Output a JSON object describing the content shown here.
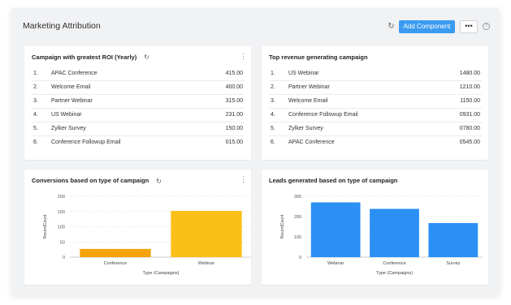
{
  "header": {
    "title": "Marketing Attribution",
    "add_component_label": "Add Component",
    "more_label": "•••",
    "help_label": "?"
  },
  "icons": {
    "refresh": "refresh-icon",
    "menu": "vertical-dots-icon",
    "help": "help-icon"
  },
  "widgets": {
    "roi": {
      "title": "Campaign with greatest ROI (Yearly)",
      "rows": [
        {
          "rank": "1.",
          "name": "APAC Conference",
          "value": "415.00"
        },
        {
          "rank": "2.",
          "name": "Welcome Email",
          "value": "400.00"
        },
        {
          "rank": "3.",
          "name": "Partner Webinar",
          "value": "315.00"
        },
        {
          "rank": "4.",
          "name": "US Webinar",
          "value": "231.00"
        },
        {
          "rank": "5.",
          "name": "Zylker Survey",
          "value": "150.00"
        },
        {
          "rank": "6.",
          "name": "Conference Followup Email",
          "value": "015.00"
        }
      ]
    },
    "revenue": {
      "title": "Top revenue generating campaign",
      "rows": [
        {
          "rank": "1.",
          "name": "US Webinar",
          "value": "1480.00"
        },
        {
          "rank": "2.",
          "name": "Partner Webinar",
          "value": "1210.00"
        },
        {
          "rank": "3.",
          "name": "Welcome Email",
          "value": "1150.00"
        },
        {
          "rank": "4.",
          "name": "Conference Followup Email",
          "value": "0931.00"
        },
        {
          "rank": "5.",
          "name": "Zylker Survey",
          "value": "0780.00"
        },
        {
          "rank": "6.",
          "name": "APAC Conference",
          "value": "0545.00"
        }
      ]
    },
    "conversions": {
      "title": "Conversions based on type of campaign"
    },
    "leads": {
      "title": "Leads generated based on type of campaign"
    }
  },
  "chart_data": [
    {
      "type": "bar",
      "title": "Conversions based on type of campaign",
      "categories": [
        "Conference",
        "Webinar"
      ],
      "values": [
        27,
        152
      ],
      "colors": [
        "#f4a30b",
        "#fbbf1a"
      ],
      "xlabel": "Type (Campaigns)",
      "ylabel": "RecordCount",
      "ylim": [
        0,
        200
      ],
      "yticks": [
        "0",
        "50",
        "100",
        "150",
        "200"
      ],
      "grid": true
    },
    {
      "type": "bar",
      "title": "Leads generated based on type of campaign",
      "categories": [
        "Webinar",
        "Conference",
        "Survey"
      ],
      "values": [
        270,
        238,
        168
      ],
      "colors": [
        "#2b8ff4",
        "#2b8ff4",
        "#2b8ff4"
      ],
      "xlabel": "Type (Campaigns)",
      "ylabel": "RecordCount",
      "ylim": [
        0,
        300
      ],
      "yticks": [
        "0",
        "100",
        "200",
        "300"
      ],
      "grid": true
    }
  ]
}
